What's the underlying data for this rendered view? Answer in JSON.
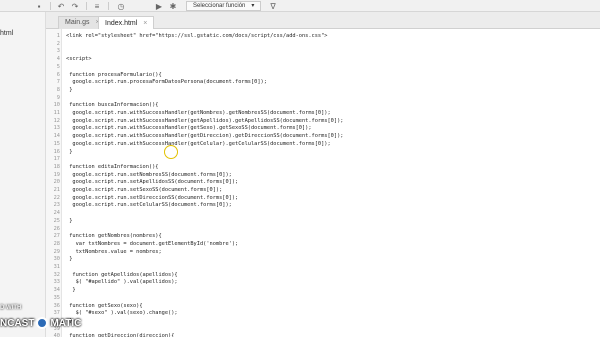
{
  "toolbar": {
    "function_select": "Seleccionar función",
    "buttons": [
      "save-icon",
      "undo-icon",
      "redo-icon",
      "indent-icon",
      "clock-icon",
      "run-icon",
      "debug-icon"
    ]
  },
  "sidebar": {
    "file_label": "html"
  },
  "tabs": [
    {
      "label": "Main.gs",
      "close": "×"
    },
    {
      "label": "Index.html",
      "close": "×"
    }
  ],
  "code_lines": [
    {
      "n": "1",
      "text": "<link rel=\"stylesheet\" href=\"https://ssl.gstatic.com/docs/script/css/add-ons.css\">"
    },
    {
      "n": "2",
      "text": ""
    },
    {
      "n": "3",
      "text": ""
    },
    {
      "n": "4",
      "text": "<script>"
    },
    {
      "n": "5",
      "text": ""
    },
    {
      "n": "6",
      "text": " function procesaFormulario(){"
    },
    {
      "n": "7",
      "text": "  google.script.run.procesaFormDatosPersona(document.forms[0]);"
    },
    {
      "n": "8",
      "text": " }"
    },
    {
      "n": "9",
      "text": ""
    },
    {
      "n": "10",
      "text": " function buscaInformacion(){"
    },
    {
      "n": "11",
      "text": "  google.script.run.withSuccessHandler(getNombres).getNombresSS(document.forms[0]);"
    },
    {
      "n": "12",
      "text": "  google.script.run.withSuccessHandler(getApellidos).getApellidosSS(document.forms[0]);"
    },
    {
      "n": "13",
      "text": "  google.script.run.withSuccessHandler(getSexo).getSexoSS(document.forms[0]);"
    },
    {
      "n": "14",
      "text": "  google.script.run.withSuccessHandler(getDireccion).getDireccionSS(document.forms[0]);"
    },
    {
      "n": "15",
      "text": "  google.script.run.withSuccessHandler(getCelular).getCelularSS(document.forms[0]);"
    },
    {
      "n": "16",
      "text": " }"
    },
    {
      "n": "17",
      "text": ""
    },
    {
      "n": "18",
      "text": " function editaInformacion(){"
    },
    {
      "n": "19",
      "text": "  google.script.run.setNombresSS(document.forms[0]);"
    },
    {
      "n": "20",
      "text": "  google.script.run.setApellidosSS(document.forms[0]);"
    },
    {
      "n": "21",
      "text": "  google.script.run.setSexoSS(document.forms[0]);"
    },
    {
      "n": "22",
      "text": "  google.script.run.setDireccionSS(document.forms[0]);"
    },
    {
      "n": "23",
      "text": "  google.script.run.setCelularSS(document.forms[0]);"
    },
    {
      "n": "24",
      "text": ""
    },
    {
      "n": "25",
      "text": " }"
    },
    {
      "n": "26",
      "text": ""
    },
    {
      "n": "27",
      "text": " function getNombres(nombres){"
    },
    {
      "n": "28",
      "text": "   var txtNombres = document.getElementById('nombre');"
    },
    {
      "n": "29",
      "text": "   txtNombres.value = nombres;"
    },
    {
      "n": "30",
      "text": " }"
    },
    {
      "n": "31",
      "text": ""
    },
    {
      "n": "32",
      "text": "  function getApellidos(apellidos){"
    },
    {
      "n": "33",
      "text": "   $( \"#apellido\" ).val(apellidos);"
    },
    {
      "n": "34",
      "text": "  }"
    },
    {
      "n": "35",
      "text": ""
    },
    {
      "n": "36",
      "text": " function getSexo(sexo){"
    },
    {
      "n": "37",
      "text": "   $( \"#sexo\" ).val(sexo).change();"
    },
    {
      "n": "38",
      "text": " }"
    },
    {
      "n": "39",
      "text": ""
    },
    {
      "n": "40",
      "text": " function getDireccion(direccion){"
    }
  ],
  "watermark": {
    "line1": "D WITH",
    "line2a": "NCAST",
    "line2b": "MATIC"
  }
}
